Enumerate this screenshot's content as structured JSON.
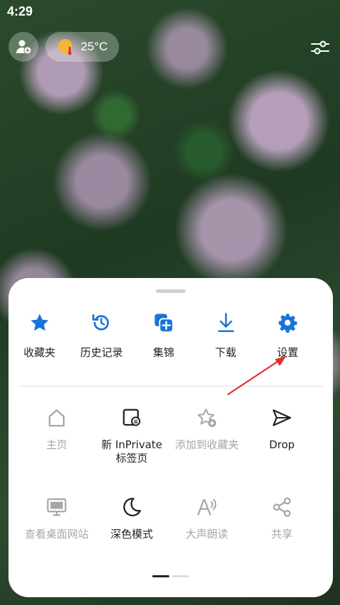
{
  "status_bar": {
    "time": "4:29"
  },
  "top_bar": {
    "weather_temp": "25°C"
  },
  "menu": {
    "primary": [
      {
        "label": "收藏夹",
        "icon": "star-icon"
      },
      {
        "label": "历史记录",
        "icon": "history-icon"
      },
      {
        "label": "集锦",
        "icon": "collections-icon"
      },
      {
        "label": "下载",
        "icon": "download-icon"
      },
      {
        "label": "设置",
        "icon": "gear-icon"
      }
    ],
    "secondary_row1": [
      {
        "label": "主页",
        "icon": "home-icon",
        "enabled": false
      },
      {
        "label_line1": "新 InPrivate",
        "label_line2": "标签页",
        "icon": "inprivate-tab-icon",
        "enabled": true
      },
      {
        "label": "添加到收藏夹",
        "icon": "add-favorite-icon",
        "enabled": false
      },
      {
        "label": "Drop",
        "icon": "send-icon",
        "enabled": true
      }
    ],
    "secondary_row2": [
      {
        "label": "查看桌面网站",
        "icon": "desktop-icon",
        "enabled": false
      },
      {
        "label": "深色模式",
        "icon": "moon-icon",
        "enabled": true
      },
      {
        "label": "大声朗读",
        "icon": "read-aloud-icon",
        "enabled": false
      },
      {
        "label": "共享",
        "icon": "share-icon",
        "enabled": false
      }
    ]
  },
  "colors": {
    "accent": "#1a73d9",
    "disabled": "#a6a6a6",
    "annotation_arrow": "#e0302a"
  }
}
